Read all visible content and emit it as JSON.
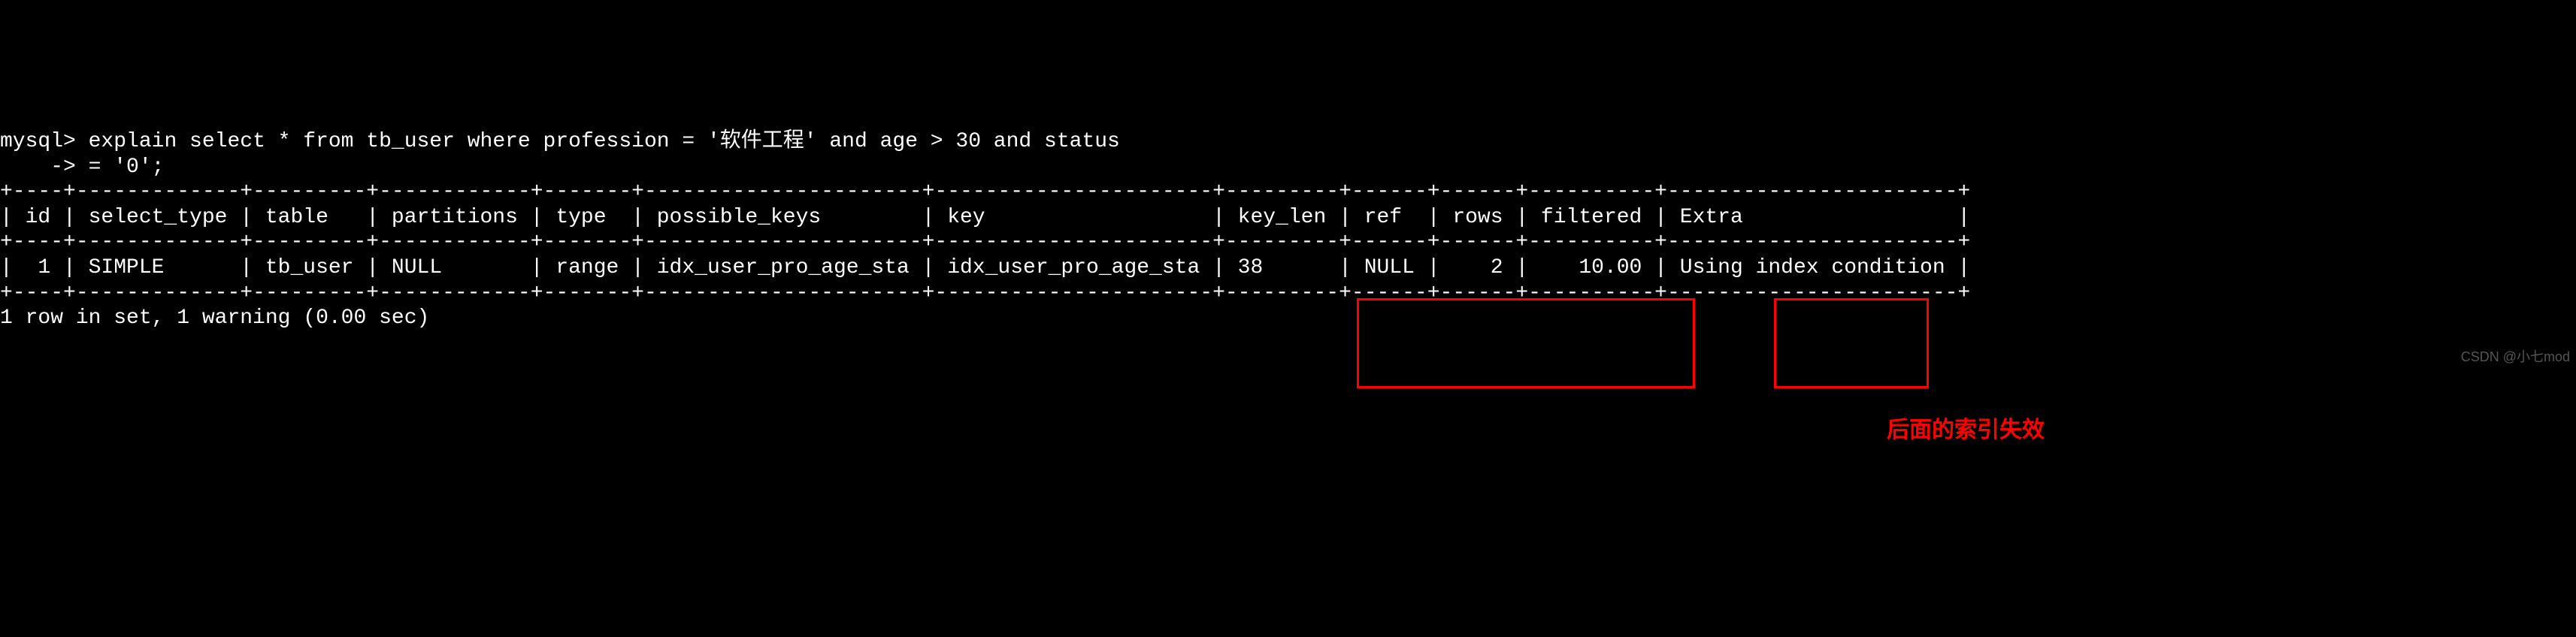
{
  "terminal": {
    "prompt": "mysql>",
    "query_line1": " explain select * from tb_user where profession = '软件工程' and age > 30 and status",
    "query_line2": "    -> = '0';",
    "sep_top": "+----+-------------+---------+------------+-------+----------------------+----------------------+---------+------+------+----------+-----------------------+",
    "header": "| id | select_type | table   | partitions | type  | possible_keys        | key                  | key_len | ref  | rows | filtered | Extra                 |",
    "sep_mid": "+----+-------------+---------+------------+-------+----------------------+----------------------+---------+------+------+----------+-----------------------+",
    "row1": "|  1 | SIMPLE      | tb_user | NULL       | range | idx_user_pro_age_sta | idx_user_pro_age_sta | 38      | NULL |    2 |    10.00 | Using index condition |",
    "sep_bot": "+----+-------------+---------+------------+-------+----------------------+----------------------+---------+------+------+----------+-----------------------+",
    "result": "1 row in set, 1 warning (0.00 sec)"
  },
  "annotation": {
    "text": "后面的索引失效"
  },
  "watermark": {
    "text": "CSDN @小七mod"
  },
  "explain_data": {
    "columns": [
      "id",
      "select_type",
      "table",
      "partitions",
      "type",
      "possible_keys",
      "key",
      "key_len",
      "ref",
      "rows",
      "filtered",
      "Extra"
    ],
    "row": {
      "id": "1",
      "select_type": "SIMPLE",
      "table": "tb_user",
      "partitions": "NULL",
      "type": "range",
      "possible_keys": "idx_user_pro_age_sta",
      "key": "idx_user_pro_age_sta",
      "key_len": "38",
      "ref": "NULL",
      "rows": "2",
      "filtered": "10.00",
      "Extra": "Using index condition"
    }
  }
}
